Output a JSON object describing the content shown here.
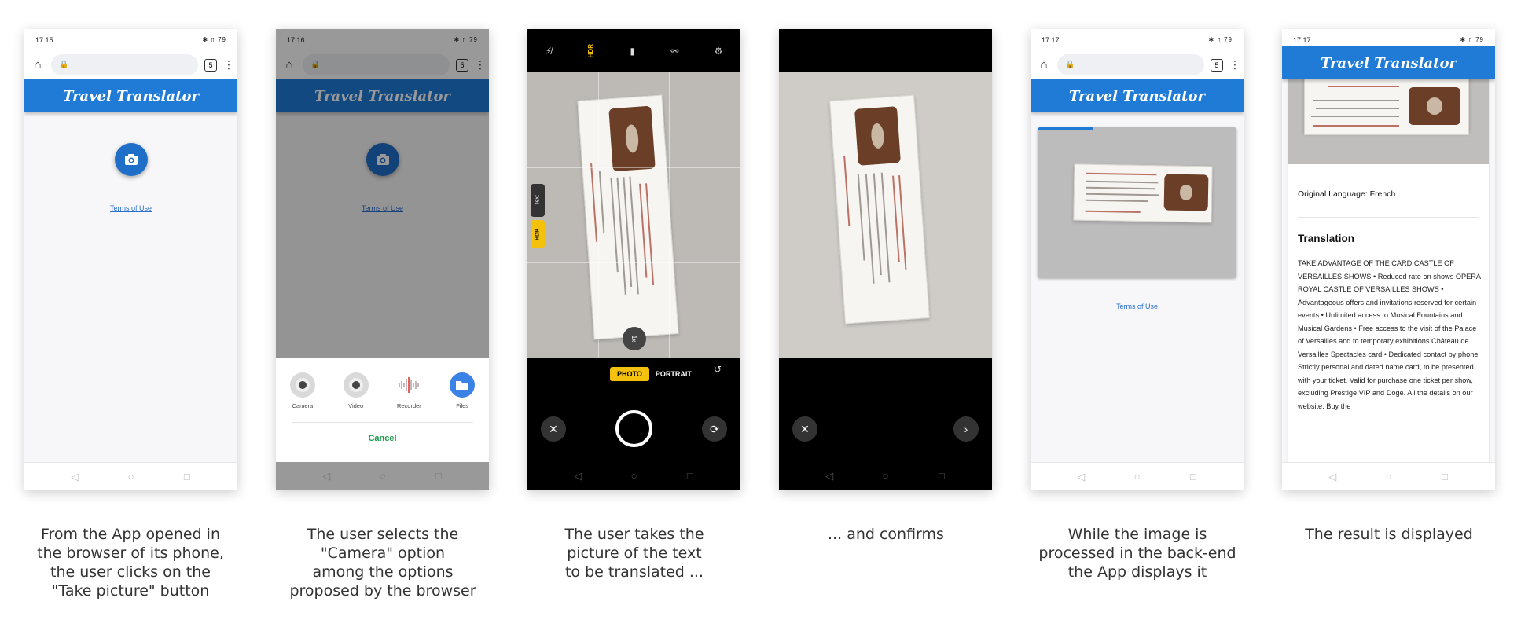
{
  "app": {
    "title": "Travel Translator",
    "terms_link": "Terms of Use",
    "brand_color": "#1f7bd6"
  },
  "screens": [
    {
      "status_time": "17:15",
      "tab_count": "5",
      "caption": "From the App opened in\nthe browser of its phone,\nthe user clicks on the\n\"Take picture\" button"
    },
    {
      "status_time": "17:16",
      "tab_count": "5",
      "picker": {
        "options": [
          "Camera",
          "Video",
          "Recorder",
          "Files"
        ],
        "cancel": "Cancel"
      },
      "caption": "The user selects the\n\"Camera\" option\namong the options\nproposed by the browser"
    },
    {
      "camera": {
        "side_text": "Text",
        "side_hdr": "HDR",
        "top_hdr": "HDR",
        "zoom": "1x",
        "mode_active": "PHOTO",
        "mode_next": "PORTRAIT"
      },
      "caption": "The user takes the\npicture of the text\nto be translated ..."
    },
    {
      "caption": "... and confirms"
    },
    {
      "status_time": "17:17",
      "tab_count": "5",
      "caption": "While the image is\nprocessed in the back-end\nthe App displays it"
    },
    {
      "status_time": "17:17",
      "result": {
        "original_language": "Original Language: French",
        "translation_heading": "Translation",
        "translation_text": "TAKE ADVANTAGE OF THE CARD CASTLE OF VERSAILLES SHOWS • Reduced rate on shows OPERA ROYAL CASTLE OF VERSAILLES SHOWS • Advantageous offers and invitations reserved for certain events • Unlimited access to Musical Fountains and Musical Gardens • Free access to the visit of the Palace of Versailles and to temporary exhibitions Château de Versailles Spectacles card • Dedicated contact by phone Strictly personal and dated name card, to be presented with your ticket. Valid for purchase one ticket per show, excluding Prestige VIP and Doge. All the details on our website. Buy the"
      },
      "caption": "The result is displayed"
    }
  ]
}
